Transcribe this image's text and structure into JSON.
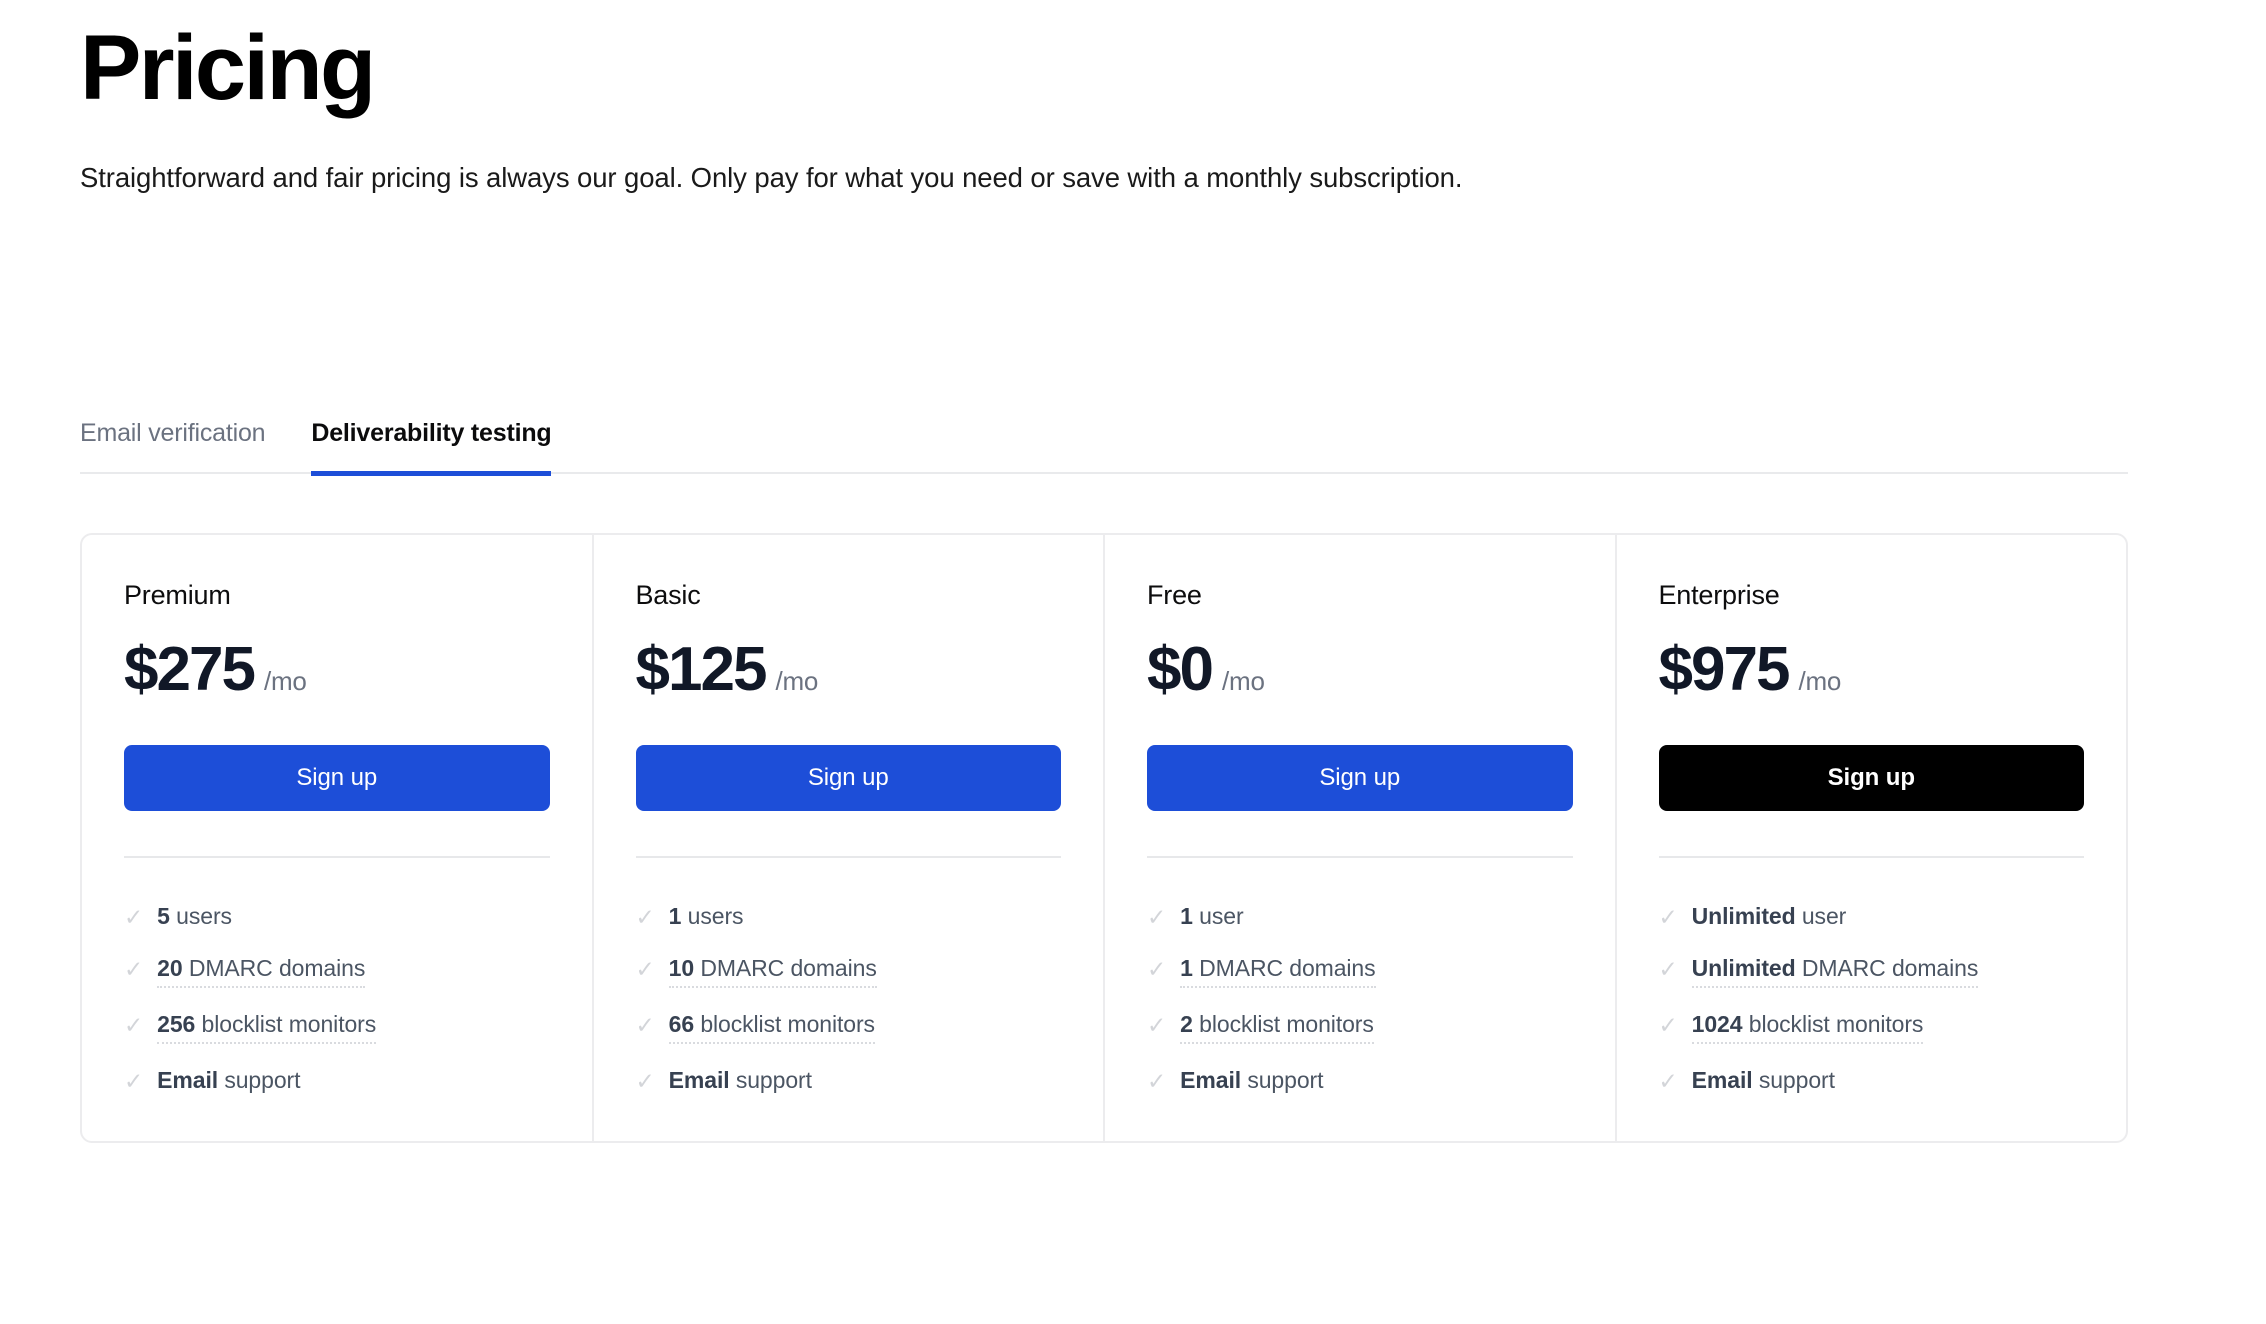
{
  "header": {
    "title": "Pricing",
    "subtitle": "Straightforward and fair pricing is always our goal. Only pay for what you need or save with a monthly subscription."
  },
  "tabs": [
    {
      "label": "Email verification",
      "active": false
    },
    {
      "label": "Deliverability testing",
      "active": true
    }
  ],
  "colors": {
    "accent_blue": "#1d4ed8",
    "enterprise_button": "#000000",
    "border": "#ececee",
    "muted_text": "#6b7280",
    "check_icon": "#d3d5d9"
  },
  "icons": {
    "check": "✓"
  },
  "plans": [
    {
      "name": "Premium",
      "price": "$275",
      "period": "/mo",
      "cta_label": "Sign up",
      "cta_style": "blue",
      "features": [
        {
          "qty": "5",
          "label": "users",
          "tooltip": false
        },
        {
          "qty": "20",
          "label": "DMARC domains",
          "tooltip": true
        },
        {
          "qty": "256",
          "label": "blocklist monitors",
          "tooltip": true
        },
        {
          "qty": "Email",
          "label": "support",
          "tooltip": false
        }
      ]
    },
    {
      "name": "Basic",
      "price": "$125",
      "period": "/mo",
      "cta_label": "Sign up",
      "cta_style": "blue",
      "features": [
        {
          "qty": "1",
          "label": "users",
          "tooltip": false
        },
        {
          "qty": "10",
          "label": "DMARC domains",
          "tooltip": true
        },
        {
          "qty": "66",
          "label": "blocklist monitors",
          "tooltip": true
        },
        {
          "qty": "Email",
          "label": "support",
          "tooltip": false
        }
      ]
    },
    {
      "name": "Free",
      "price": "$0",
      "period": "/mo",
      "cta_label": "Sign up",
      "cta_style": "blue",
      "features": [
        {
          "qty": "1",
          "label": "user",
          "tooltip": false
        },
        {
          "qty": "1",
          "label": "DMARC domains",
          "tooltip": true
        },
        {
          "qty": "2",
          "label": "blocklist monitors",
          "tooltip": true
        },
        {
          "qty": "Email",
          "label": "support",
          "tooltip": false
        }
      ]
    },
    {
      "name": "Enterprise",
      "price": "$975",
      "period": "/mo",
      "cta_label": "Sign up",
      "cta_style": "dark",
      "features": [
        {
          "qty": "Unlimited",
          "label": "user",
          "tooltip": false
        },
        {
          "qty": "Unlimited",
          "label": "DMARC domains",
          "tooltip": true
        },
        {
          "qty": "1024",
          "label": "blocklist monitors",
          "tooltip": true
        },
        {
          "qty": "Email",
          "label": "support",
          "tooltip": false
        }
      ]
    }
  ]
}
